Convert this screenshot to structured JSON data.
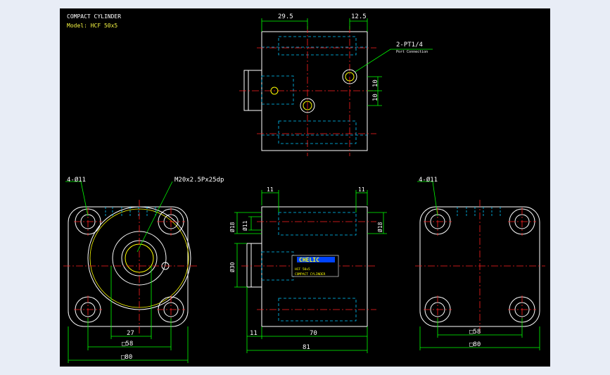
{
  "title_block": {
    "title": "COMPACT CYLINDER",
    "model": "Model: HCF 50x5"
  },
  "top_view": {
    "dim_left": "29.5",
    "dim_right": "12.5",
    "port_callout": "2-PT1/4",
    "port_callout_sub": "Port Connection",
    "dim_v1": "10",
    "dim_v2": "10"
  },
  "front_view": {
    "holes": "4-Ø11",
    "thread": "M20x2.5Px25dp",
    "dim_27": "27",
    "dim_58": "□58",
    "dim_80": "□80"
  },
  "side_view": {
    "dim_11_left": "11",
    "dim_11_right": "11",
    "dim_phi18_left": "Ø18",
    "dim_phi11": "Ø11",
    "dim_phi18_right": "Ø18",
    "dim_phi30": "Ø30",
    "brand": "CHELIC",
    "label_model": "HCF 50x5",
    "label_desc": "COMPACT CYLINDER",
    "dim_bottom_11": "11",
    "dim_70": "70",
    "dim_81": "81"
  },
  "rear_view": {
    "holes": "4-Ø11",
    "dim_58": "□58",
    "dim_80": "□80"
  },
  "colors": {
    "outline": "#ffffff",
    "hidden": "#00c8ff",
    "center": "#ff2020",
    "dimension": "#00ff00",
    "highlight": "#ffff00"
  }
}
